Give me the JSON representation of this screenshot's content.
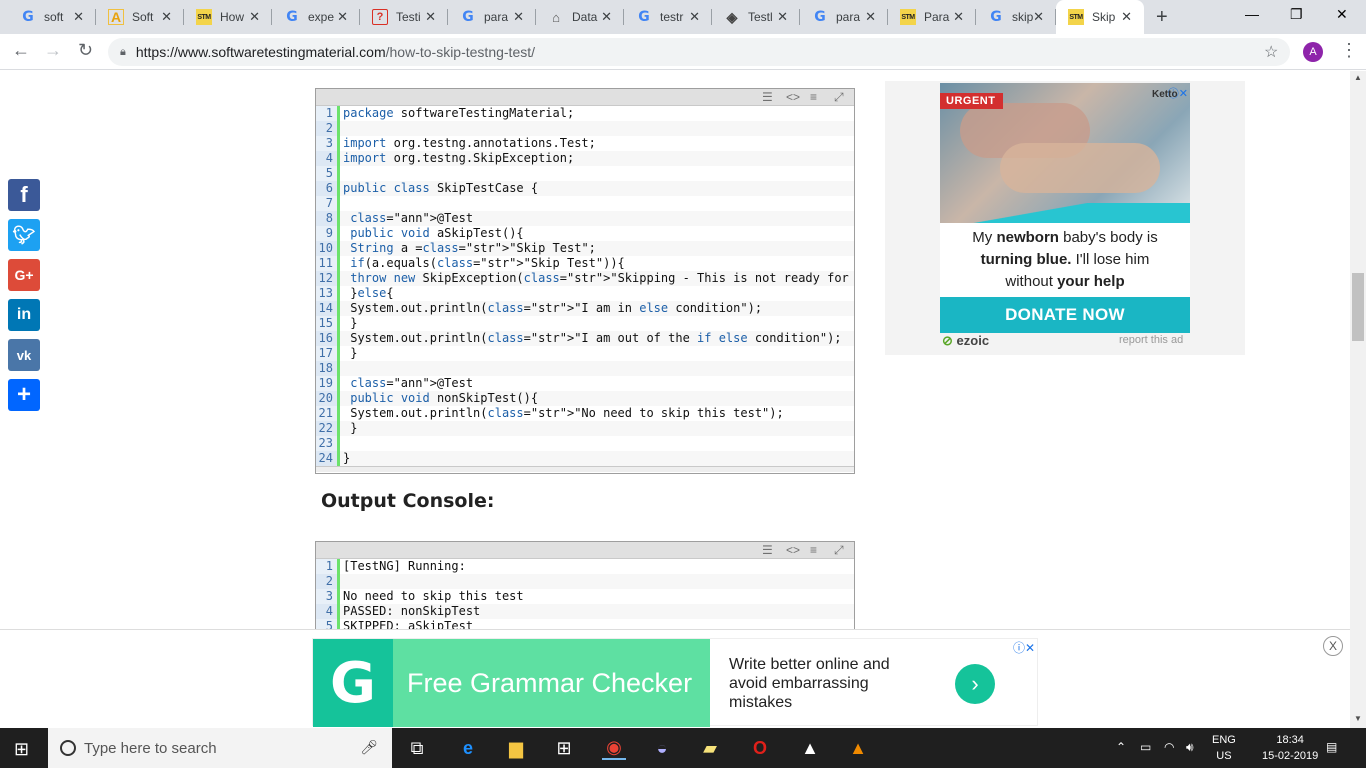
{
  "browser": {
    "tabs": [
      {
        "title": "soft",
        "icon": "google-icon"
      },
      {
        "title": "Soft",
        "icon": "a-icon"
      },
      {
        "title": "How",
        "icon": "stm-icon"
      },
      {
        "title": "expe",
        "icon": "google-icon"
      },
      {
        "title": "Testi",
        "icon": "q-icon"
      },
      {
        "title": "para",
        "icon": "google-icon"
      },
      {
        "title": "Data",
        "icon": "data-icon"
      },
      {
        "title": "testr",
        "icon": "google-icon"
      },
      {
        "title": "Testl",
        "icon": "diamond-icon"
      },
      {
        "title": "para",
        "icon": "google-icon"
      },
      {
        "title": "Para",
        "icon": "stm-icon"
      },
      {
        "title": "skip",
        "icon": "google-icon"
      },
      {
        "title": "Skip",
        "icon": "stm-icon",
        "active": true
      }
    ],
    "url_host": "https://www.softwaretestingmaterial.com",
    "url_path": "/how-to-skip-testng-test/",
    "profile_initial": "A"
  },
  "code_main": {
    "lines": [
      {
        "n": "1",
        "text": "package softwareTestingMaterial;"
      },
      {
        "n": "2",
        "text": ""
      },
      {
        "n": "3",
        "text": "import org.testng.annotations.Test;"
      },
      {
        "n": "4",
        "text": "import org.testng.SkipException;"
      },
      {
        "n": "5",
        "text": ""
      },
      {
        "n": "6",
        "text": "public class SkipTestCase {"
      },
      {
        "n": "7",
        "text": ""
      },
      {
        "n": "8",
        "text": " @Test"
      },
      {
        "n": "9",
        "text": " public void aSkipTest(){"
      },
      {
        "n": "10",
        "text": " String a =\"Skip Test\";"
      },
      {
        "n": "11",
        "text": " if(a.equals(\"Skip Test\")){"
      },
      {
        "n": "12",
        "text": " throw new SkipException(\"Skipping - This is not ready for testing \");"
      },
      {
        "n": "13",
        "text": " }else{"
      },
      {
        "n": "14",
        "text": " System.out.println(\"I am in else condition\");"
      },
      {
        "n": "15",
        "text": " }"
      },
      {
        "n": "16",
        "text": " System.out.println(\"I am out of the if else condition\");"
      },
      {
        "n": "17",
        "text": " }"
      },
      {
        "n": "18",
        "text": ""
      },
      {
        "n": "19",
        "text": " @Test"
      },
      {
        "n": "20",
        "text": " public void nonSkipTest(){"
      },
      {
        "n": "21",
        "text": " System.out.println(\"No need to skip this test\");"
      },
      {
        "n": "22",
        "text": " }"
      },
      {
        "n": "23",
        "text": ""
      },
      {
        "n": "24",
        "text": "}"
      }
    ]
  },
  "output_heading": "Output Console:",
  "code_output": {
    "lines": [
      {
        "n": "1",
        "text": "[TestNG] Running:"
      },
      {
        "n": "2",
        "text": ""
      },
      {
        "n": "3",
        "text": "No need to skip this test"
      },
      {
        "n": "4",
        "text": "PASSED: nonSkipTest"
      },
      {
        "n": "5",
        "text": "SKIPPED: aSkipTest"
      }
    ]
  },
  "ad_right": {
    "urgent": "URGENT",
    "corner_brand": "Ketto",
    "line1_pre": "My ",
    "line1_bold": "newborn",
    "line1_post": " baby's body is",
    "line2_bold": "turning blue.",
    "line2_post": " I'll lose him",
    "line3_pre": "without ",
    "line3_bold": "your help",
    "donate": "DONATE NOW",
    "ezoic": "ezoic",
    "report": "report this ad"
  },
  "ad_bottom": {
    "logo_letter": "G",
    "headline": "Free Grammar Checker",
    "description": "Write better online and avoid embarrassing mistakes",
    "close": "X"
  },
  "taskbar": {
    "search_placeholder": "Type here to search",
    "lang_top": "ENG",
    "lang_bottom": "US",
    "time": "18:34",
    "date": "15-02-2019"
  },
  "colors": {
    "tab_strip": "#dee1e6",
    "taskbar": "#1f1f1f",
    "donate": "#1ab6c4",
    "grammarly": "#15c39a"
  }
}
